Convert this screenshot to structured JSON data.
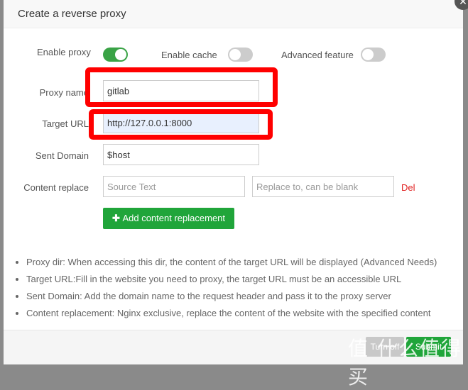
{
  "dialog": {
    "title": "Create a reverse proxy",
    "close_icon": "close-icon"
  },
  "toggles": [
    {
      "label": "Enable proxy",
      "on": true
    },
    {
      "label": "Enable cache",
      "on": false
    },
    {
      "label": "Advanced feature",
      "on": false
    }
  ],
  "fields": {
    "proxy_name": {
      "label": "Proxy name",
      "value": "gitlab"
    },
    "target_url": {
      "label": "Target URL",
      "value": "http://127.0.0.1:8000"
    },
    "sent_domain": {
      "label": "Sent Domain",
      "value": "$host"
    },
    "content_replace": {
      "label": "Content replace",
      "source_placeholder": "Source Text",
      "replace_placeholder": "Replace to, can be blank",
      "del": "Del"
    }
  },
  "add_button": "Add content replacement",
  "notes": [
    "Proxy dir: When accessing this dir, the content of the target URL will be displayed (Advanced Needs)",
    "Target URL:Fill in the website you need to proxy, the target URL must be an accessible URL",
    "Sent Domain: Add the domain name to the request header and pass it to the proxy server",
    "Content replacement: Nginx exclusive, replace the content of the website with the specified content"
  ],
  "footer": {
    "cancel": "Turn off",
    "submit": "Submit"
  },
  "watermark": "值 什么值得买",
  "colors": {
    "accent": "#20a53a",
    "annotation": "#ff0000",
    "del": "#e02020"
  }
}
